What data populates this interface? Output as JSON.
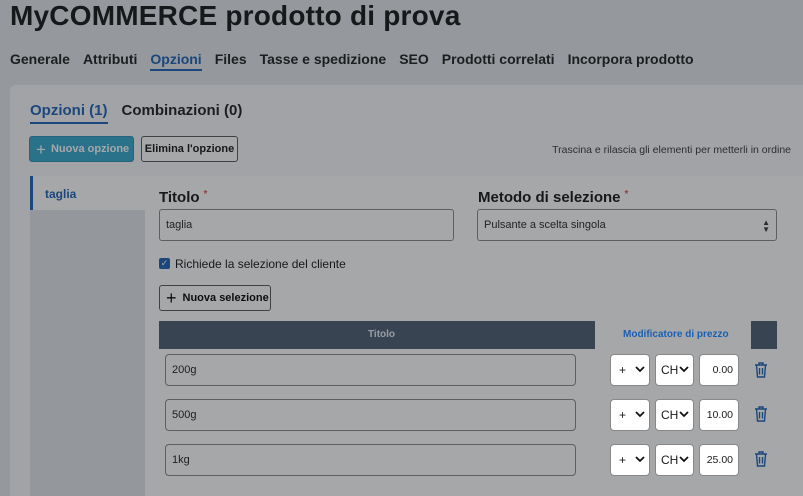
{
  "page": {
    "title": "MyCOMMERCE prodotto di prova"
  },
  "tabs": [
    {
      "label": "Generale"
    },
    {
      "label": "Attributi"
    },
    {
      "label": "Opzioni"
    },
    {
      "label": "Files"
    },
    {
      "label": "Tasse e spedizione"
    },
    {
      "label": "SEO"
    },
    {
      "label": "Prodotti correlati"
    },
    {
      "label": "Incorpora prodotto"
    }
  ],
  "subtabs": [
    {
      "label": "Opzioni (1)"
    },
    {
      "label": "Combinazioni (0)"
    }
  ],
  "toolbar": {
    "new_option_label": "Nuova opzione",
    "delete_option_label": "Elimina l'opzione",
    "hint": "Trascina e rilascia gli elementi per metterli in ordine"
  },
  "options": [
    {
      "label": "taglia"
    }
  ],
  "form": {
    "title_label": "Titolo",
    "title_value": "taglia",
    "method_label": "Metodo di selezione",
    "method_value": "Pulsante a scelta singola",
    "required_marker": "*",
    "checkbox_label": "Richiede la selezione del cliente",
    "new_selection_label": "Nuova selezione"
  },
  "table": {
    "col_title": "Titolo",
    "col_modifier": "Modificatore di prezzo",
    "rows": [
      {
        "title": "200g",
        "sign": "+",
        "currency": "CH",
        "amount": "0.00"
      },
      {
        "title": "500g",
        "sign": "+",
        "currency": "CH",
        "amount": "10.00"
      },
      {
        "title": "1kg",
        "sign": "+",
        "currency": "CH",
        "amount": "25.00"
      }
    ]
  },
  "colors": {
    "accent": "#1a5fb4",
    "primary_button": "#33a6cc",
    "table_header": "#4a5b6e"
  }
}
